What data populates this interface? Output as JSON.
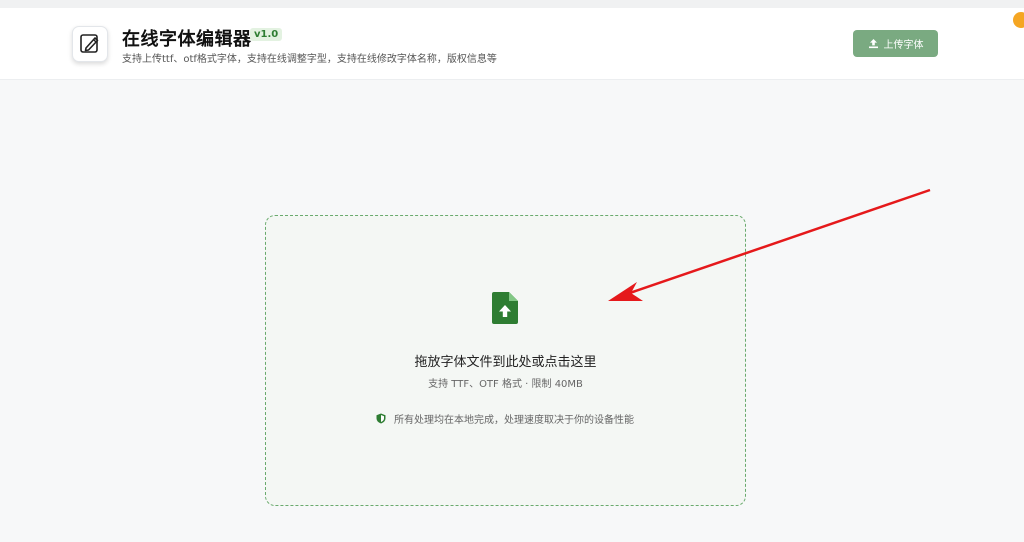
{
  "header": {
    "title": "在线字体编辑器",
    "version": "v1.0",
    "subtitle": "支持上传ttf、otf格式字体，支持在线调整字型，支持在线修改字体名称，版权信息等",
    "upload_label": "上传字体"
  },
  "dropzone": {
    "title": "拖放字体文件到此处或点击这里",
    "limit": "支持 TTF、OTF 格式 · 限制 40MB",
    "privacy": "所有处理均在本地完成，处理速度取决于你的设备性能"
  },
  "colors": {
    "accent": "#2e7d32",
    "button": "#7aaa81",
    "dropzone_border": "#6aaa6e",
    "arrow": "#e5191b",
    "corner_badge": "#f5a623"
  },
  "icons": {
    "logo": "pen-edit-icon",
    "upload": "upload-icon",
    "file": "file-upload-icon",
    "privacy": "shield-icon"
  }
}
